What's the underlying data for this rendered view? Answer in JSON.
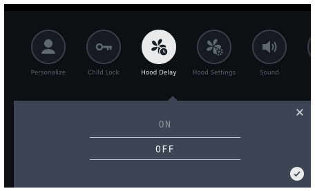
{
  "menu": {
    "items": [
      {
        "label": "Personalize",
        "icon": "user-icon"
      },
      {
        "label": "Child Lock",
        "icon": "key-icon"
      },
      {
        "label": "Hood Delay",
        "icon": "fan-clock-icon",
        "active": true
      },
      {
        "label": "Hood Settings",
        "icon": "fan-gear-icon"
      },
      {
        "label": "Sound",
        "icon": "speaker-icon"
      }
    ]
  },
  "dialog": {
    "options": [
      "ON",
      "OFF"
    ],
    "selected": "OFF",
    "close_icon": "close-icon",
    "confirm_icon": "checkmark-icon"
  },
  "colors": {
    "background": "#0c0f14",
    "panel": "#3d4453",
    "active": "#e9eaec",
    "inactive": "#5e6670"
  }
}
